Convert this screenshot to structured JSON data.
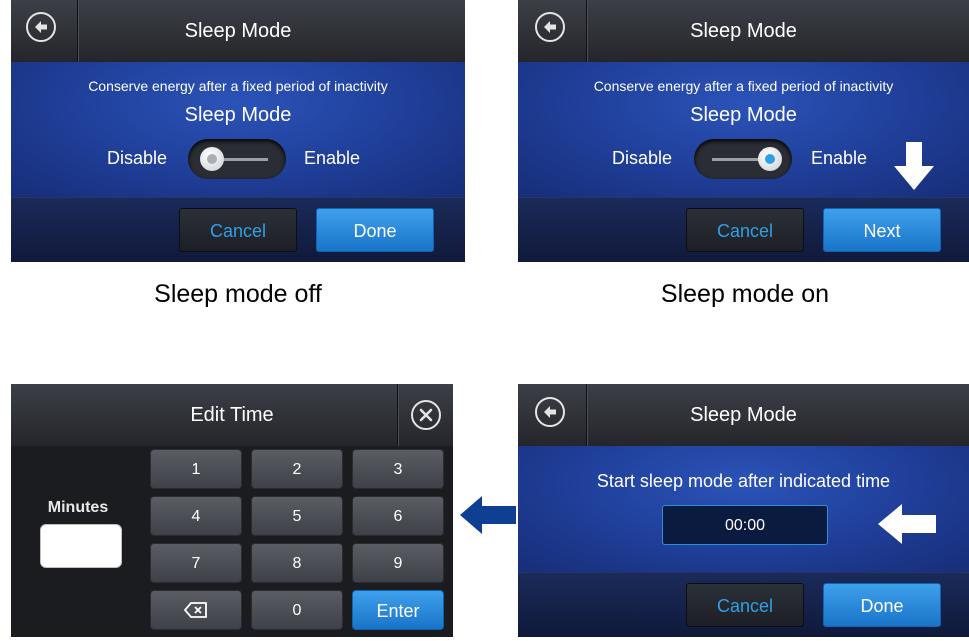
{
  "panel_off": {
    "title": "Sleep Mode",
    "description": "Conserve energy after a fixed period of inactivity",
    "setting_label": "Sleep Mode",
    "disable_label": "Disable",
    "enable_label": "Enable",
    "toggle_state": "off",
    "cancel_label": "Cancel",
    "done_label": "Done",
    "caption": "Sleep mode off"
  },
  "panel_on": {
    "title": "Sleep Mode",
    "description": "Conserve energy after a fixed period of inactivity",
    "setting_label": "Sleep Mode",
    "disable_label": "Disable",
    "enable_label": "Enable",
    "toggle_state": "on",
    "cancel_label": "Cancel",
    "next_label": "Next",
    "caption": "Sleep mode on"
  },
  "panel_time": {
    "title": "Sleep Mode",
    "prompt": "Start sleep mode after indicated time",
    "time_value": "00:00",
    "cancel_label": "Cancel",
    "done_label": "Done"
  },
  "keypad": {
    "title": "Edit Time",
    "field_label": "Minutes",
    "field_value": "",
    "keys": [
      "1",
      "2",
      "3",
      "4",
      "5",
      "6",
      "7",
      "8",
      "9",
      "0"
    ],
    "enter_label": "Enter"
  },
  "colors": {
    "accent_blue": "#2ea1e6",
    "panel_blue": "#1f3e98",
    "arrow_blue": "#0e3f93"
  }
}
